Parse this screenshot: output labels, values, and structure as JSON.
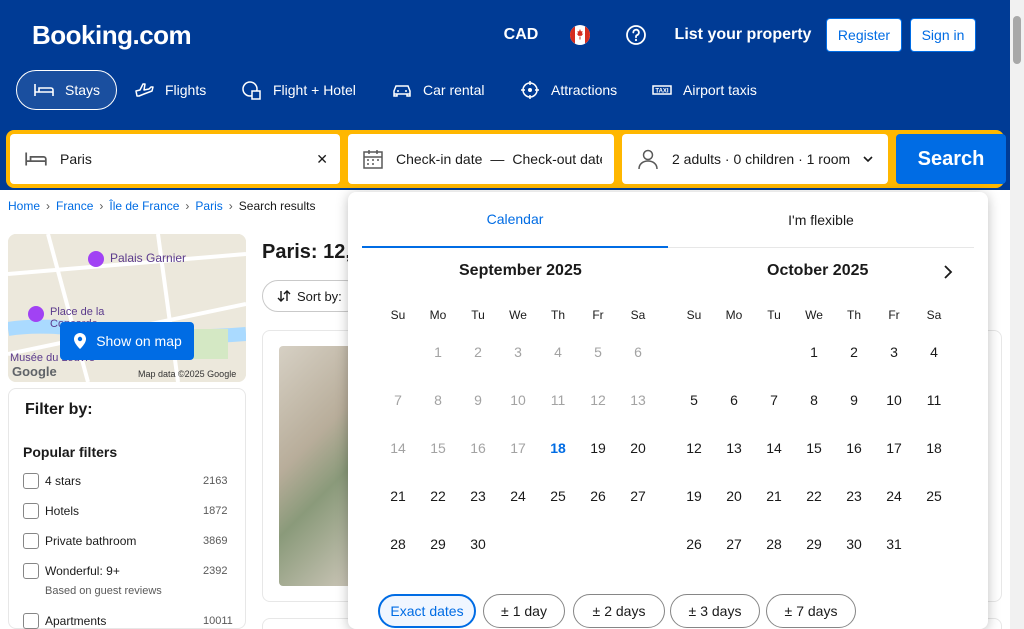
{
  "header": {
    "logo": "Booking.com",
    "currency": "CAD",
    "list_property": "List your property",
    "register": "Register",
    "sign_in": "Sign in"
  },
  "nav": [
    {
      "label": "Stays",
      "icon": "bed-icon"
    },
    {
      "label": "Flights",
      "icon": "plane-icon"
    },
    {
      "label": "Flight + Hotel",
      "icon": "flight-hotel-icon"
    },
    {
      "label": "Car rental",
      "icon": "car-icon"
    },
    {
      "label": "Attractions",
      "icon": "attractions-icon"
    },
    {
      "label": "Airport taxis",
      "icon": "taxi-icon"
    }
  ],
  "search": {
    "destination": "Paris",
    "checkin": "Check-in date",
    "dash": "—",
    "checkout": "Check-out date",
    "guests": "2 adults · 0 children · 1 room",
    "button": "Search"
  },
  "breadcrumb": [
    "Home",
    "France",
    "Île de France",
    "Paris",
    "Search results"
  ],
  "map": {
    "labels": [
      "Palais Garnier",
      "Place de la Concorde",
      "Musée du Louvre",
      "Google",
      "Map data ©2025 Google"
    ],
    "button": "Show on map"
  },
  "filters": {
    "title": "Filter by:",
    "popular": "Popular filters",
    "items": [
      {
        "label": "4 stars",
        "count": "2163"
      },
      {
        "label": "Hotels",
        "count": "1872"
      },
      {
        "label": "Private bathroom",
        "count": "3869"
      },
      {
        "label": "Wonderful: 9+",
        "count": "2392"
      },
      {
        "label": "Apartments",
        "count": "10011"
      }
    ],
    "note": "Based on guest reviews"
  },
  "results": {
    "title": "Paris: 12,",
    "sort": "Sort by:"
  },
  "calendar": {
    "tabs": [
      "Calendar",
      "I'm flexible"
    ],
    "months": [
      {
        "title": "September 2025",
        "offset": 1,
        "days": 30,
        "today": 18,
        "past_until": 17
      },
      {
        "title": "October 2025",
        "offset": 3,
        "days": 31,
        "today": 0,
        "past_until": 0
      }
    ],
    "weekdays": [
      "Su",
      "Mo",
      "Tu",
      "We",
      "Th",
      "Fr",
      "Sa"
    ],
    "chips": [
      {
        "label": "Exact dates",
        "active": true
      },
      {
        "label": "1 day",
        "active": false
      },
      {
        "label": "2 days",
        "active": false
      },
      {
        "label": "3 days",
        "active": false
      },
      {
        "label": "7 days",
        "active": false
      }
    ],
    "chip_prefix": "±"
  },
  "colors": {
    "brand_blue": "#003b95",
    "accent_blue": "#006ce4",
    "search_yellow": "#ffb700"
  }
}
